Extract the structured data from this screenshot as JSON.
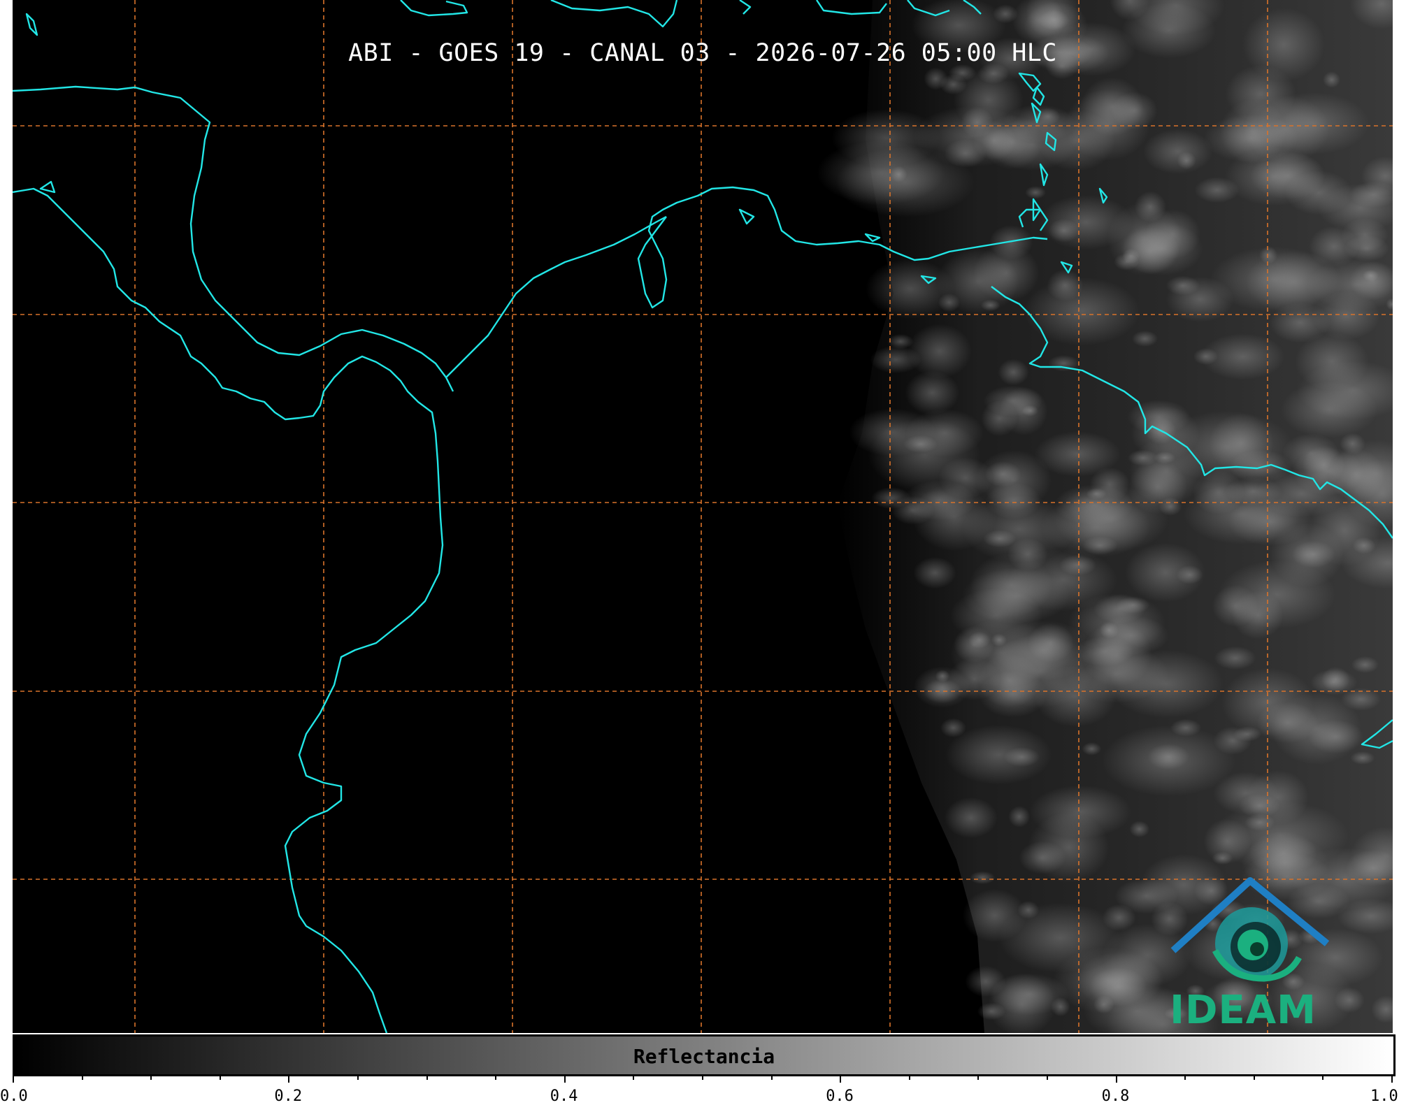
{
  "title": "ABI - GOES 19 - CANAL 03 - 2026-07-26 05:00 HLC",
  "colors": {
    "coastline": "#22e6e6",
    "gridline": "#d9732a",
    "background": "#000000",
    "logo_blue": "#1f7fc4",
    "logo_green": "#1bb07f"
  },
  "logo": {
    "text": "IDEAM",
    "icon": "ideam-mountain-swirl-icon"
  },
  "colorbar": {
    "label": "Reflectancia",
    "ticks": [
      "0.0",
      "0.2",
      "0.4",
      "0.6",
      "0.8",
      "1.0"
    ]
  }
}
